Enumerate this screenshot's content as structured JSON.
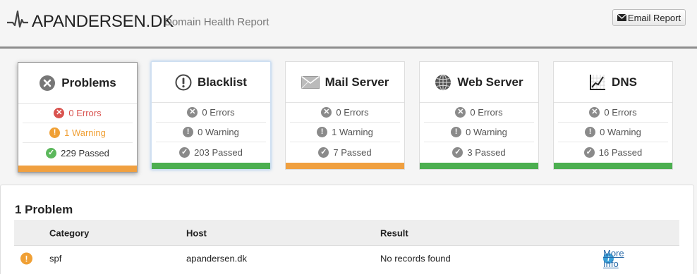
{
  "header": {
    "title": "APANDERSEN.DK",
    "subtitle": "Domain Health Report",
    "email_button": "Email Report"
  },
  "cards": [
    {
      "title": "Problems",
      "icon": "x-circle-icon",
      "bar_color": "#f0a040",
      "rows": [
        {
          "text": "0 Errors",
          "status": "error"
        },
        {
          "text": "1 Warning",
          "status": "warning"
        },
        {
          "text": "229 Passed",
          "status": "passed"
        }
      ]
    },
    {
      "title": "Blacklist",
      "icon": "exclamation-circle-icon",
      "bar_color": "#4caf50",
      "rows": [
        {
          "text": "0 Errors",
          "status": "none"
        },
        {
          "text": "0 Warning",
          "status": "none"
        },
        {
          "text": "203 Passed",
          "status": "none"
        }
      ]
    },
    {
      "title": "Mail Server",
      "icon": "envelope-icon",
      "bar_color": "#f0a040",
      "rows": [
        {
          "text": "0 Errors",
          "status": "none"
        },
        {
          "text": "1 Warning",
          "status": "none"
        },
        {
          "text": "7 Passed",
          "status": "none"
        }
      ]
    },
    {
      "title": "Web Server",
      "icon": "globe-icon",
      "bar_color": "#4caf50",
      "rows": [
        {
          "text": "0 Errors",
          "status": "none"
        },
        {
          "text": "0 Warning",
          "status": "none"
        },
        {
          "text": "3 Passed",
          "status": "none"
        }
      ]
    },
    {
      "title": "DNS",
      "icon": "chart-icon",
      "bar_color": "#4caf50",
      "rows": [
        {
          "text": "0 Errors",
          "status": "none"
        },
        {
          "text": "0 Warning",
          "status": "none"
        },
        {
          "text": "16 Passed",
          "status": "none"
        }
      ]
    }
  ],
  "problems": {
    "title": "1 Problem",
    "columns": [
      "Category",
      "Host",
      "Result"
    ],
    "rows": [
      {
        "category": "spf",
        "host": "apandersen.dk",
        "result": "No records found",
        "link": "More Info"
      }
    ]
  },
  "colors": {
    "error": "#d9534f",
    "warning": "#f0a035",
    "passed": "#5cb85c",
    "neutral": "#8a8a8a"
  }
}
